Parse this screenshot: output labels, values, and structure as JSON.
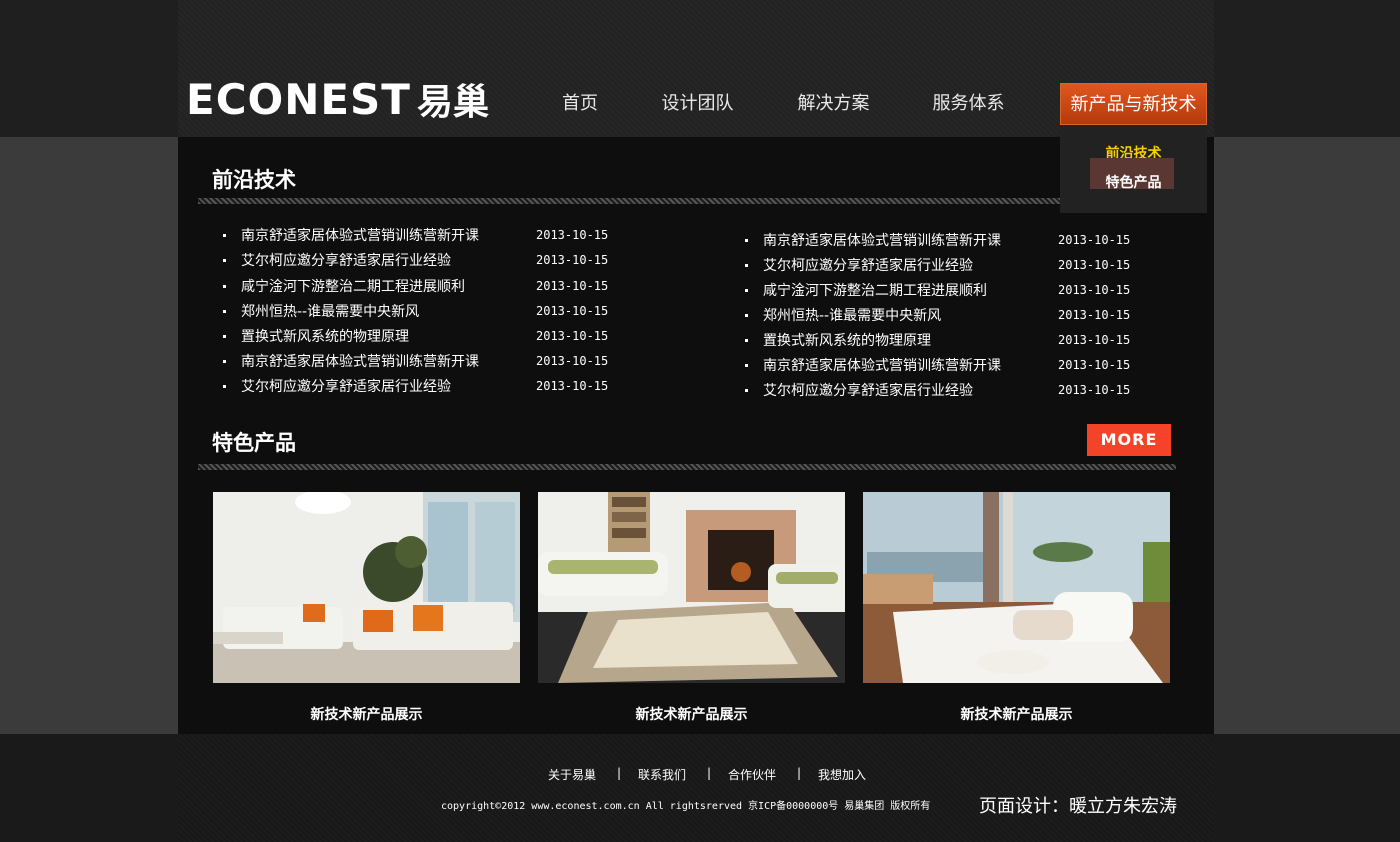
{
  "brand": {
    "logo_text": "ECONEST",
    "logo_cn": "易巢"
  },
  "nav": {
    "items": [
      "首页",
      "设计团队",
      "解决方案",
      "服务体系",
      "新产品与新技术"
    ],
    "active_index": 4,
    "dropdown": [
      "前沿技术",
      "特色产品"
    ]
  },
  "frontier": {
    "title": "前沿技术",
    "left_items": [
      {
        "title": "南京舒适家居体验式营销训练营新开课",
        "date": "2013-10-15"
      },
      {
        "title": "艾尔柯应邀分享舒适家居行业经验",
        "date": "2013-10-15"
      },
      {
        "title": "咸宁淦河下游整治二期工程进展顺利",
        "date": "2013-10-15"
      },
      {
        "title": "郑州恒热--谁最需要中央新风",
        "date": "2013-10-15"
      },
      {
        "title": "置换式新风系统的物理原理",
        "date": "2013-10-15"
      },
      {
        "title": "南京舒适家居体验式营销训练营新开课",
        "date": "2013-10-15"
      },
      {
        "title": "艾尔柯应邀分享舒适家居行业经验",
        "date": "2013-10-15"
      }
    ],
    "right_items": [
      {
        "title": "南京舒适家居体验式营销训练营新开课",
        "date": "2013-10-15"
      },
      {
        "title": "艾尔柯应邀分享舒适家居行业经验",
        "date": "2013-10-15"
      },
      {
        "title": "咸宁淦河下游整治二期工程进展顺利",
        "date": "2013-10-15"
      },
      {
        "title": "郑州恒热--谁最需要中央新风",
        "date": "2013-10-15"
      },
      {
        "title": "置换式新风系统的物理原理",
        "date": "2013-10-15"
      },
      {
        "title": "南京舒适家居体验式营销训练营新开课",
        "date": "2013-10-15"
      },
      {
        "title": "艾尔柯应邀分享舒适家居行业经验",
        "date": "2013-10-15"
      }
    ]
  },
  "featured": {
    "title": "特色产品",
    "more_label": "MORE",
    "products": [
      {
        "caption": "新技术新产品展示"
      },
      {
        "caption": "新技术新产品展示"
      },
      {
        "caption": "新技术新产品展示"
      }
    ]
  },
  "footer": {
    "links": [
      "关于易巢",
      "联系我们",
      "合作伙伴",
      "我想加入"
    ],
    "separator": "|",
    "copyright": "copyright©2012 www.econest.com.cn All rightsrerved 京ICP备0000000号 易巢集团 版权所有",
    "designer": "页面设计：暖立方朱宏涛"
  },
  "colors": {
    "accent": "#d44b16",
    "more_button": "#f5432a",
    "dropdown_active": "#f5d000"
  }
}
